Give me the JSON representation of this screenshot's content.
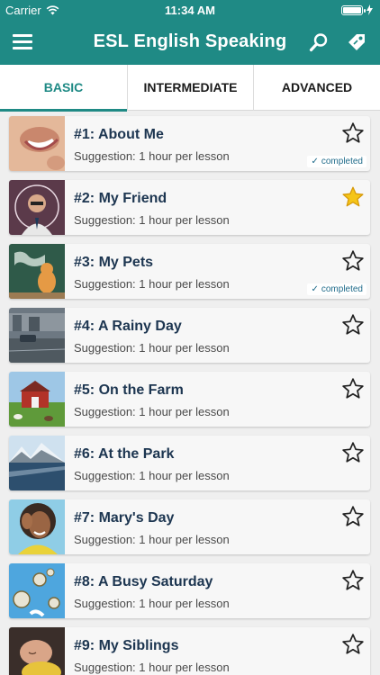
{
  "status_bar": {
    "carrier": "Carrier",
    "time": "11:34 AM",
    "battery_level": 1.0
  },
  "header": {
    "title": "ESL English Speaking",
    "background": "#1f8a85",
    "icons": [
      "menu-icon",
      "search-icon",
      "tag-icon"
    ]
  },
  "tabs": [
    {
      "label": "BASIC",
      "active": true
    },
    {
      "label": "INTERMEDIATE",
      "active": false
    },
    {
      "label": "ADVANCED",
      "active": false
    }
  ],
  "lessons": [
    {
      "title": "#1: About Me",
      "suggestion": "Suggestion: 1 hour per lesson",
      "favorite": false,
      "completed": true,
      "image": "smiling-face-thumbnail"
    },
    {
      "title": "#2: My Friend",
      "suggestion": "Suggestion: 1 hour per lesson",
      "favorite": true,
      "completed": false,
      "image": "man-with-glasses-thumbnail"
    },
    {
      "title": "#3: My Pets",
      "suggestion": "Suggestion: 1 hour per lesson",
      "favorite": false,
      "completed": true,
      "image": "cat-at-blackboard-thumbnail"
    },
    {
      "title": "#4: A Rainy Day",
      "suggestion": "Suggestion: 1 hour per lesson",
      "favorite": false,
      "completed": false,
      "image": "rainy-street-thumbnail"
    },
    {
      "title": "#5: On the Farm",
      "suggestion": "Suggestion: 1 hour per lesson",
      "favorite": false,
      "completed": false,
      "image": "red-barn-thumbnail"
    },
    {
      "title": "#6: At the Park",
      "suggestion": "Suggestion: 1 hour per lesson",
      "favorite": false,
      "completed": false,
      "image": "mountain-lake-thumbnail"
    },
    {
      "title": "#7: Mary's Day",
      "suggestion": "Suggestion: 1 hour per lesson",
      "favorite": false,
      "completed": false,
      "image": "smiling-woman-thumbnail"
    },
    {
      "title": "#8: A Busy Saturday",
      "suggestion": "Suggestion: 1 hour per lesson",
      "favorite": false,
      "completed": false,
      "image": "flying-clocks-thumbnail"
    },
    {
      "title": "#9: My Siblings",
      "suggestion": "Suggestion: 1 hour per lesson",
      "favorite": false,
      "completed": false,
      "image": "sleeping-baby-thumbnail"
    }
  ],
  "completed_label": "completed",
  "colors": {
    "accent": "#1f8a85",
    "title_text": "#1c3550",
    "favorite_star": "#f5c518"
  }
}
